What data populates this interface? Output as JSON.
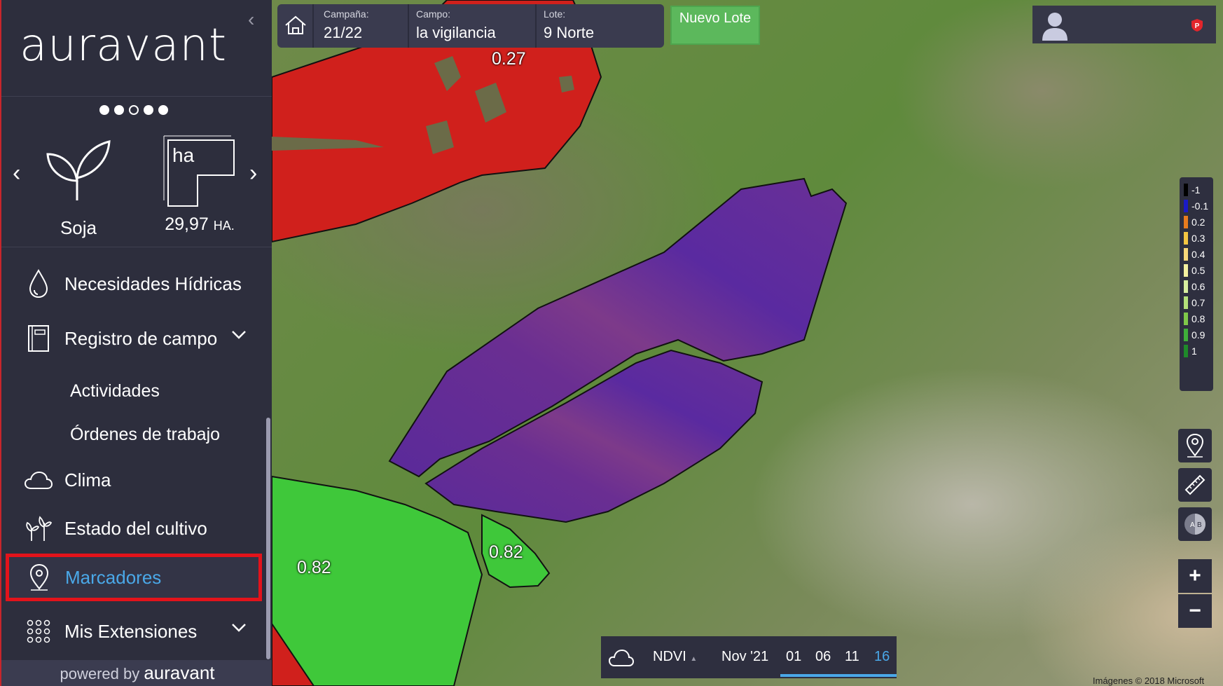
{
  "sidebar": {
    "logo": "auravant",
    "crop": {
      "name": "Soja"
    },
    "area": {
      "unit_box": "ha",
      "value": "29,97",
      "unit": "HA."
    },
    "menu": {
      "hidricas": "Necesidades Hídricas",
      "registro": "Registro de campo",
      "actividades": "Actividades",
      "ordenes": "Órdenes de trabajo",
      "clima": "Clima",
      "estado": "Estado del cultivo",
      "marcadores": "Marcadores",
      "extensiones": "Mis Extensiones"
    },
    "powered_prefix": "powered by",
    "powered_brand": "auravant"
  },
  "topbar": {
    "campana_key": "Campaña:",
    "campana_value": "21/22",
    "campo_key": "Campo:",
    "campo_value": "la vigilancia",
    "lote_key": "Lote:",
    "lote_value": "9 Norte",
    "nuevo_lote": "Nuevo Lote"
  },
  "map": {
    "labels": {
      "red": "0.27",
      "green_large": "0.82",
      "green_small": "0.82"
    },
    "legend": [
      {
        "label": "-1",
        "color": "#000000"
      },
      {
        "label": "-0.1",
        "color": "#1a1ac8"
      },
      {
        "label": "0.2",
        "color": "#e87b1e"
      },
      {
        "label": "0.3",
        "color": "#f5c542"
      },
      {
        "label": "0.4",
        "color": "#f8d77a"
      },
      {
        "label": "0.5",
        "color": "#f4f0a0"
      },
      {
        "label": "0.6",
        "color": "#d8eea0"
      },
      {
        "label": "0.7",
        "color": "#b4e07a"
      },
      {
        "label": "0.8",
        "color": "#7fc84a"
      },
      {
        "label": "0.9",
        "color": "#3fae3a"
      },
      {
        "label": "1",
        "color": "#1f8a2a"
      }
    ],
    "copyright": "Imágenes © 2018 Microsoft"
  },
  "timebar": {
    "layer": "NDVI",
    "month": "Nov '21",
    "days": [
      "01",
      "06",
      "11",
      "16"
    ],
    "active_day": "16"
  }
}
